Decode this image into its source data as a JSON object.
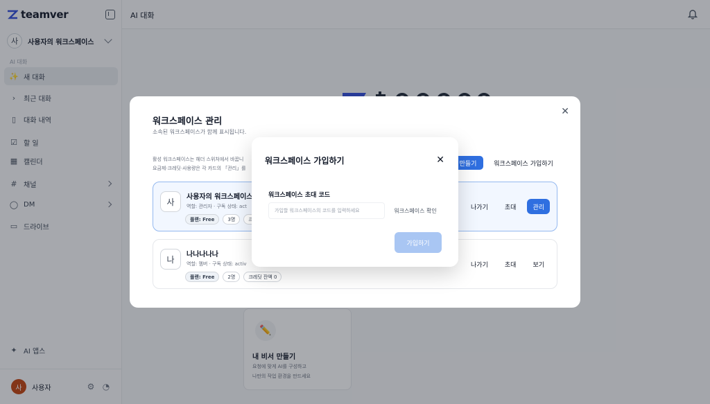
{
  "sidebar": {
    "logo_text": "teamver",
    "workspace": {
      "avatar": "사",
      "name": "사용자의 워크스페이스"
    },
    "section_label": "AI 대화",
    "items": [
      {
        "label": "새 대화",
        "icon": "sparkle-icon"
      },
      {
        "label": "최근 대화",
        "icon": "chevron-right-icon"
      },
      {
        "label": "대화 내역",
        "icon": "book-icon"
      },
      {
        "label": "할 일",
        "icon": "checkbox-icon"
      },
      {
        "label": "캘린더",
        "icon": "calendar-icon"
      },
      {
        "label": "채널",
        "icon": "hash-icon"
      },
      {
        "label": "DM",
        "icon": "chat-bubble-icon"
      },
      {
        "label": "드라이브",
        "icon": "folder-icon"
      }
    ],
    "ai_apps_label": "AI 앱스",
    "user": {
      "avatar": "사",
      "name": "사용자"
    }
  },
  "header": {
    "title": "AI 대화"
  },
  "background_card": {
    "icon": "✏️",
    "title": "내 비서 만들기",
    "desc_line1": "요청에 맞게 AI를 구성하고",
    "desc_line2": "나만의 작업 환경을 만드세요"
  },
  "manage_modal": {
    "title": "워크스페이스 관리",
    "subtitle": "소속된 워크스페이스가 함께 표시됩니다.",
    "hint_line1": "활성 워크스페이스는 헤더 스위처에서 바꿉니",
    "hint_line2": "요금제·크레딧·사용량은 각 카드의 「관리」를",
    "create_label": "만들기",
    "join_label": "워크스페이스 가입하기",
    "workspaces": [
      {
        "avatar": "사",
        "name": "사용자의 워크스페이스",
        "meta": "역할: 관리자 · 구독 상태: act",
        "badges": [
          "플랜: Free",
          "3명",
          "크레"
        ],
        "actions": [
          "나가기",
          "초대",
          "관리"
        ],
        "current": true
      },
      {
        "avatar": "나",
        "name": "나나나나나",
        "meta": "역할: 멤버 · 구독 상태: activ",
        "badges": [
          "플랜: Free",
          "2명",
          "크레딧 잔액 0"
        ],
        "actions": [
          "나가기",
          "초대",
          "보기"
        ],
        "current": false
      }
    ]
  },
  "join_dialog": {
    "title": "워크스페이스 가입하기",
    "field_label": "워크스페이스 초대 코드",
    "input_value": "",
    "input_placeholder": "가입할 워크스페이스의 코드를 입력하세요",
    "verify_label": "워크스페이스 확인",
    "submit_label": "가입하기"
  },
  "colors": {
    "primary": "#2f6fe0",
    "primary_disabled": "#a9c6f3"
  }
}
